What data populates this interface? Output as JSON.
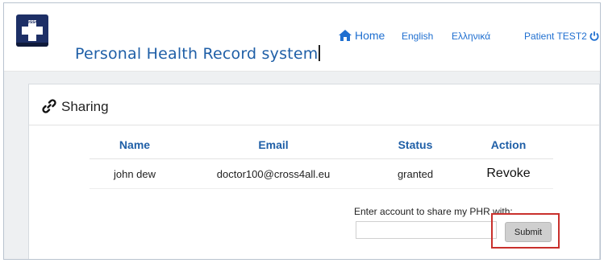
{
  "header": {
    "logo_text": "Cross4all",
    "site_title": "Personal Health Record system",
    "nav": {
      "home": "Home",
      "english": "English",
      "greek": "Ελληνικά",
      "user": "Patient TEST2"
    }
  },
  "sharing": {
    "title": "Sharing",
    "columns": [
      "Name",
      "Email",
      "Status",
      "Action"
    ],
    "rows": [
      {
        "name": "john dew",
        "email": "doctor100@cross4all.eu",
        "status": "granted",
        "action": "Revoke"
      }
    ],
    "share_label": "Enter account to share my PHR with:",
    "share_input_value": "",
    "submit_label": "Submit"
  },
  "colors": {
    "brand_blue": "#1f5fa7",
    "link_blue": "#1f6fd0",
    "highlight_red": "#c9302c",
    "logo_navy": "#1d2f66"
  },
  "icons": {
    "home": "home-icon",
    "logout": "power-icon",
    "sharing": "link-icon"
  }
}
